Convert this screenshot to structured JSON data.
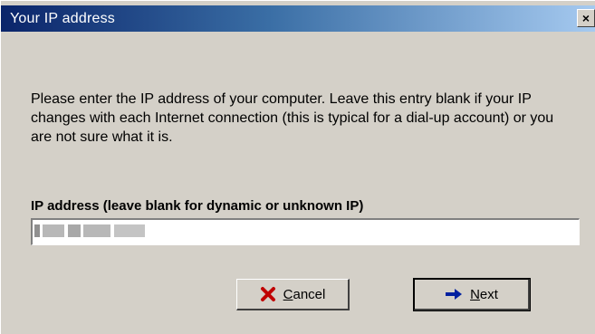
{
  "window": {
    "title": "Your IP address",
    "close_glyph": "×"
  },
  "description": "Please enter the IP address of your computer. Leave this entry blank if your IP changes with each Internet connection (this is typical for a dial-up account) or you are not sure what it is.",
  "ip_field": {
    "label": "IP address (leave blank for dynamic or unknown IP)",
    "value": ""
  },
  "buttons": {
    "cancel": {
      "mnemonic": "C",
      "rest": "ancel",
      "icon": "cancel-icon"
    },
    "next": {
      "mnemonic": "N",
      "rest": "ext",
      "icon": "arrow-right-icon"
    }
  },
  "colors": {
    "title_gradient_start": "#0a246a",
    "title_gradient_end": "#a6caf0",
    "dialog_bg": "#d4d0c8",
    "cancel_icon": "#c00000",
    "next_arrow": "#0020a0"
  }
}
